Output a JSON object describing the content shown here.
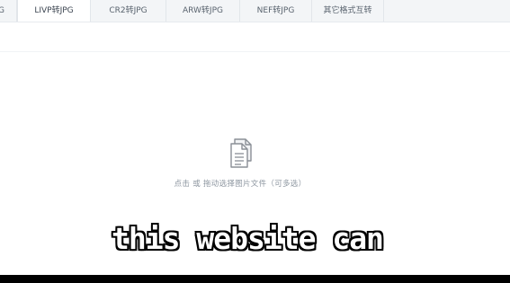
{
  "tabs": [
    {
      "label": "G",
      "active": false
    },
    {
      "label": "LIVP转JPG",
      "active": true
    },
    {
      "label": "CR2转JPG",
      "active": false
    },
    {
      "label": "ARW转JPG",
      "active": false
    },
    {
      "label": "NEF转JPG",
      "active": false
    },
    {
      "label": "其它格式互转",
      "active": false
    }
  ],
  "dropzone": {
    "icon": "document-copy-icon",
    "hint": "点击 或 拖动选择图片文件（可多选）"
  },
  "overlay": {
    "subtitle": "this website can"
  },
  "colors": {
    "tab_bar_bg": "#f3f5f7",
    "active_tab_bg": "#ffffff",
    "hint_text": "#8d96a0",
    "icon": "#8a8f96"
  }
}
